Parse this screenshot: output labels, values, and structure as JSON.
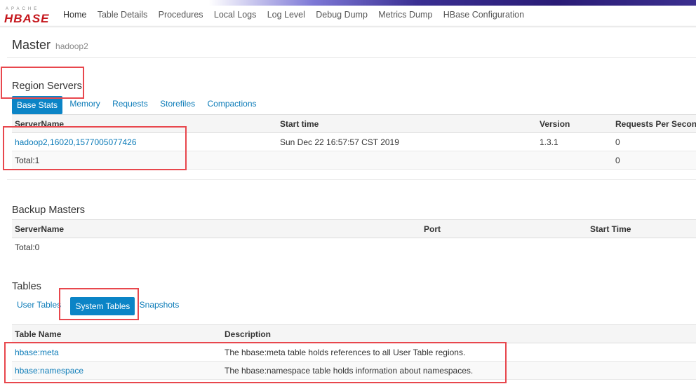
{
  "brand": {
    "apache": "APACHE",
    "name": "HBASE"
  },
  "nav": [
    "Home",
    "Table Details",
    "Procedures",
    "Local Logs",
    "Log Level",
    "Debug Dump",
    "Metrics Dump",
    "HBase Configuration"
  ],
  "master": {
    "title": "Master",
    "host": "hadoop2"
  },
  "region_servers": {
    "title": "Region Servers",
    "tabs": [
      "Base Stats",
      "Memory",
      "Requests",
      "Storefiles",
      "Compactions"
    ],
    "active_tab": "Base Stats",
    "columns": [
      "ServerName",
      "Start time",
      "Version",
      "Requests Per Second"
    ],
    "rows": [
      {
        "server": "hadoop2,16020,1577005077426",
        "start": "Sun Dec 22 16:57:57 CST 2019",
        "version": "1.3.1",
        "rps": "0"
      }
    ],
    "total": {
      "label": "Total:1",
      "rps": "0"
    }
  },
  "backup_masters": {
    "title": "Backup Masters",
    "columns": [
      "ServerName",
      "Port",
      "Start Time"
    ],
    "total": "Total:0"
  },
  "tables": {
    "title": "Tables",
    "tabs": [
      "User Tables",
      "System Tables",
      "Snapshots"
    ],
    "active_tab": "System Tables",
    "columns": [
      "Table Name",
      "Description"
    ],
    "rows": [
      {
        "name": "hbase:meta",
        "description": "The hbase:meta table holds references to all User Table regions."
      },
      {
        "name": "hbase:namespace",
        "description": "The hbase:namespace table holds information about namespaces."
      }
    ]
  },
  "colors": {
    "link": "#0b7bb8",
    "active_tab": "#0b84c6",
    "annotation": "#e8474d",
    "brand": "#c5161c"
  }
}
